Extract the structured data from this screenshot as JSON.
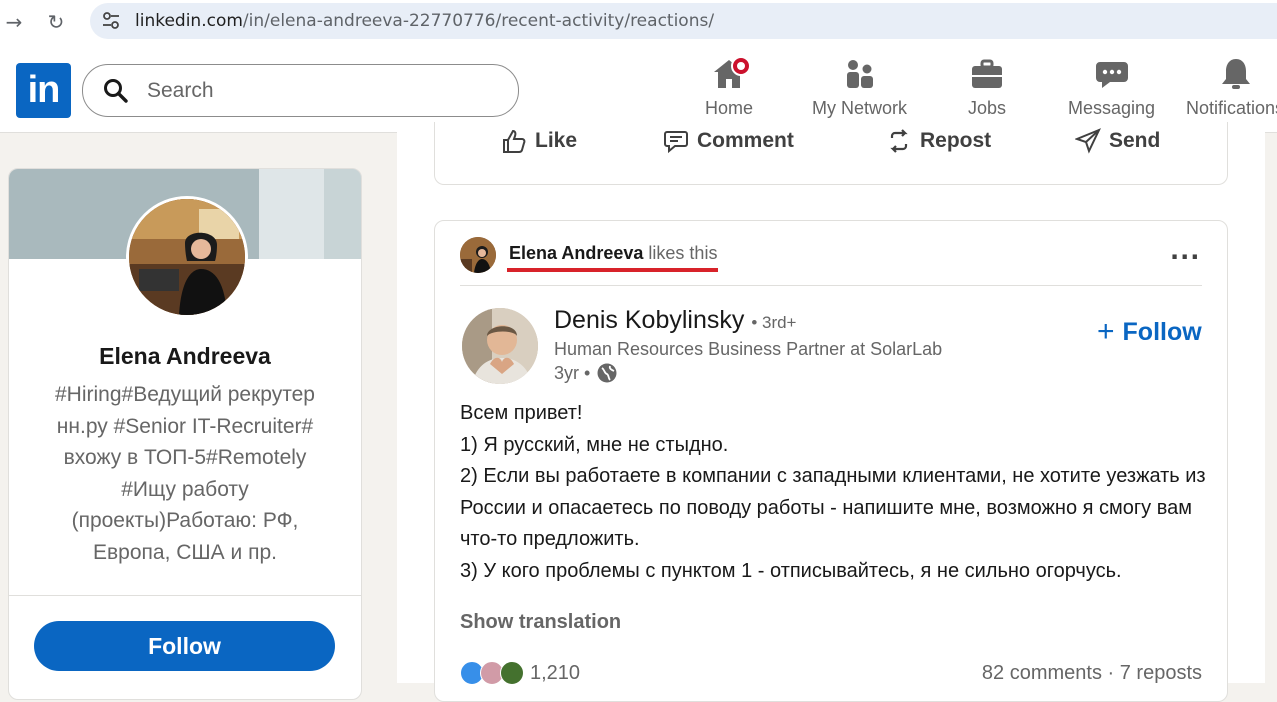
{
  "browser": {
    "url_domain": "linkedin.com",
    "url_path": "/in/elena-andreeva-22770776/recent-activity/reactions/"
  },
  "header": {
    "logo": "in",
    "search_placeholder": "Search",
    "nav": [
      {
        "label": "Home",
        "icon": "home-icon"
      },
      {
        "label": "My Network",
        "icon": "network-icon"
      },
      {
        "label": "Jobs",
        "icon": "briefcase-icon"
      },
      {
        "label": "Messaging",
        "icon": "messaging-icon"
      },
      {
        "label": "Notifications",
        "icon": "bell-icon"
      }
    ]
  },
  "profile": {
    "name": "Elena Andreeva",
    "headline": "#Hiring#Ведущий рекрутер нн.ру #Senior IT-Recruiter# вхожу в ТОП-5#Remotely #Ищу работу (проекты)Работаю: РФ, Европа, США и пр.",
    "follow_label": "Follow"
  },
  "prev_post_actions": {
    "like": "Like",
    "comment": "Comment",
    "repost": "Repost",
    "send": "Send"
  },
  "post": {
    "liker_name": "Elena Andreeva",
    "liker_suffix": "likes this",
    "author": {
      "name": "Denis Kobylinsky",
      "degree": "• 3rd+",
      "title": "Human Resources Business Partner at SolarLab",
      "time": "3yr •"
    },
    "follow_label": "Follow",
    "body": [
      "Всем привет!",
      "1) Я русский, мне не стыдно.",
      "2) Если вы работаете в компании с западными клиентами, не хотите уезжать из России и опасаетесь по поводу работы - напишите мне, возможно я смогу вам что-то предложить.",
      "3) У кого проблемы с пунктом 1 - отписывайтесь, я не сильно огорчусь."
    ],
    "show_translation": "Show translation",
    "reaction_count": "1,210",
    "comments_reposts": "82 comments · 7 reposts"
  },
  "colors": {
    "brand": "#0a66c2",
    "underline": "#d8232a",
    "notification": "#cb112d"
  }
}
